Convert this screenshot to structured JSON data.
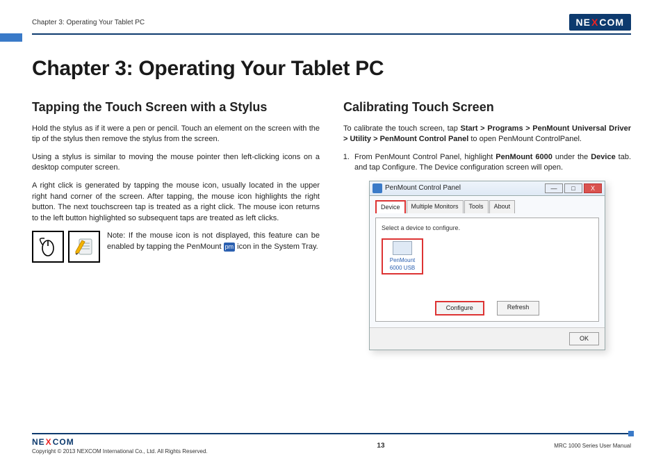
{
  "header": {
    "chapter_ref": "Chapter 3: Operating Your Tablet PC",
    "logo_part1": "NE",
    "logo_x": "X",
    "logo_part2": "COM"
  },
  "title": "Chapter 3: Operating Your Tablet PC",
  "left": {
    "heading": "Tapping the Touch Screen with a Stylus",
    "p1": "Hold the stylus as if it were a pen or pencil. Touch an element on the screen with the tip of the stylus then remove the stylus from the screen.",
    "p2": "Using a stylus is similar to moving the mouse pointer then left-clicking icons on a desktop computer screen.",
    "p3": "A right click is generated by tapping the mouse icon, usually located in the upper right hand corner of the screen. After tapping, the mouse icon highlights the right button. The next touchscreen tap is treated as a right click. The mouse icon returns to the left button highlighted so subsequent taps are treated as left clicks.",
    "note_pre": "Note: If the mouse icon is not displayed, this feature can be enabled by tapping the PenMount ",
    "note_badge": "pm",
    "note_post": " icon in the System Tray."
  },
  "right": {
    "heading": "Calibrating Touch Screen",
    "intro_pre": "To calibrate the touch screen, tap ",
    "intro_bold": "Start > Programs > PenMount Universal Driver > Utility > PenMount Control Panel",
    "intro_post": " to open PenMount ControlPanel.",
    "step1_pre": "From PenMount Control Panel, highlight ",
    "step1_b1": "PenMount 6000",
    "step1_mid": " under the ",
    "step1_b2": "Device",
    "step1_post": " tab. and tap Configure. The Device configuration screen will open."
  },
  "dialog": {
    "title": "PenMount Control Panel",
    "tab_device": "Device",
    "tab_multi": "Multiple Monitors",
    "tab_tools": "Tools",
    "tab_about": "About",
    "inner_label": "Select a device to configure.",
    "device_line1": "PenMount",
    "device_line2": "6000 USB",
    "btn_configure": "Configure",
    "btn_refresh": "Refresh",
    "btn_ok": "OK",
    "win_min": "—",
    "win_max": "□",
    "win_close": "X"
  },
  "footer": {
    "logo_part1": "NE",
    "logo_x": "X",
    "logo_part2": "COM",
    "copyright": "Copyright © 2013 NEXCOM International Co., Ltd. All Rights Reserved.",
    "page_no": "13",
    "doc_title": "MRC 1000 Series User Manual"
  }
}
